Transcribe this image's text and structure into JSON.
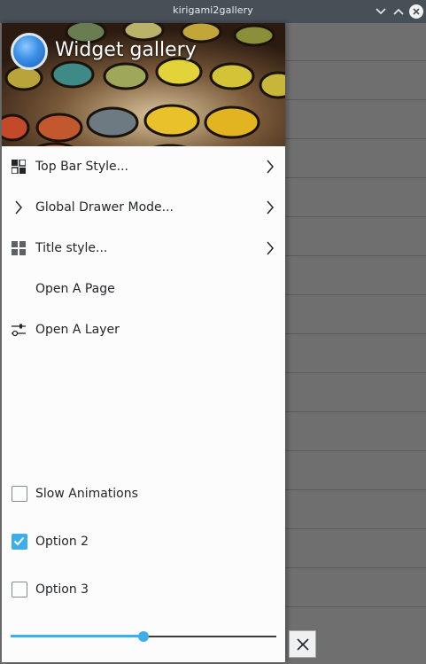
{
  "window": {
    "title": "kirigami2gallery"
  },
  "drawer": {
    "title": "Widget gallery",
    "items": [
      {
        "label": "Top Bar Style...",
        "icon": "grid-icon",
        "has_submenu": true
      },
      {
        "label": "Global Drawer Mode...",
        "icon": "chevron-right-icon",
        "has_submenu": true
      },
      {
        "label": "Title style...",
        "icon": "tiles-icon",
        "has_submenu": true
      },
      {
        "label": "Open A Page",
        "icon": "",
        "has_submenu": false
      },
      {
        "label": "Open A Layer",
        "icon": "sliders-icon",
        "has_submenu": false
      }
    ],
    "options": [
      {
        "label": "Slow Animations",
        "checked": false
      },
      {
        "label": "Option 2",
        "checked": true
      },
      {
        "label": "Option 3",
        "checked": false
      }
    ],
    "slider_value": 0.5
  },
  "colors": {
    "accent": "#3daee9",
    "titlebar": "#475057",
    "background": "#6f6f6f"
  }
}
